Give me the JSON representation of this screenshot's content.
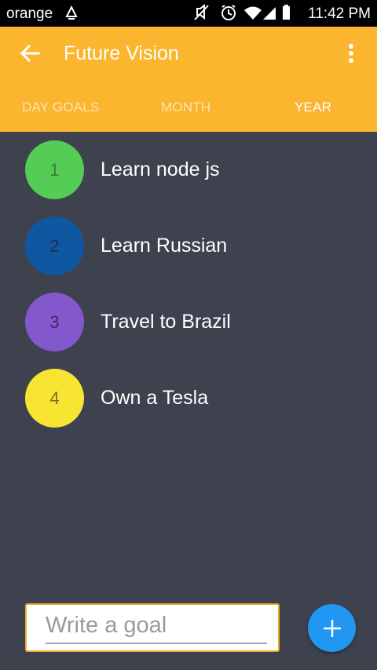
{
  "status_bar": {
    "carrier": "orange",
    "time": "11:42 PM",
    "icons": [
      "carrier-signal-icon",
      "mute-icon",
      "alarm-icon",
      "wifi-icon",
      "signal-icon",
      "battery-icon"
    ]
  },
  "app_bar": {
    "title": "Future Vision",
    "back_icon": "arrow-left-icon",
    "menu_icon": "more-vertical-icon",
    "color": "#fbb52f"
  },
  "tabs": [
    {
      "label": "DAY GOALS",
      "active": false
    },
    {
      "label": "MONTH",
      "active": false
    },
    {
      "label": "YEAR",
      "active": true
    }
  ],
  "goals": [
    {
      "number": "1",
      "text": "Learn node js",
      "color": "#55cc55",
      "number_color": "#3a7a3a"
    },
    {
      "number": "2",
      "text": "Learn Russian",
      "color": "#0e57a1",
      "number_color": "#1f2f4a"
    },
    {
      "number": "3",
      "text": "Travel to Brazil",
      "color": "#8358cc",
      "number_color": "#3d2a66"
    },
    {
      "number": "4",
      "text": "Own a Tesla",
      "color": "#f7e531",
      "number_color": "#7a6f22"
    }
  ],
  "input": {
    "placeholder": "Write a goal",
    "value": ""
  },
  "fab": {
    "icon": "plus-icon",
    "color": "#2196f3"
  },
  "colors": {
    "background": "#3e424e",
    "accent": "#fbb52f"
  }
}
